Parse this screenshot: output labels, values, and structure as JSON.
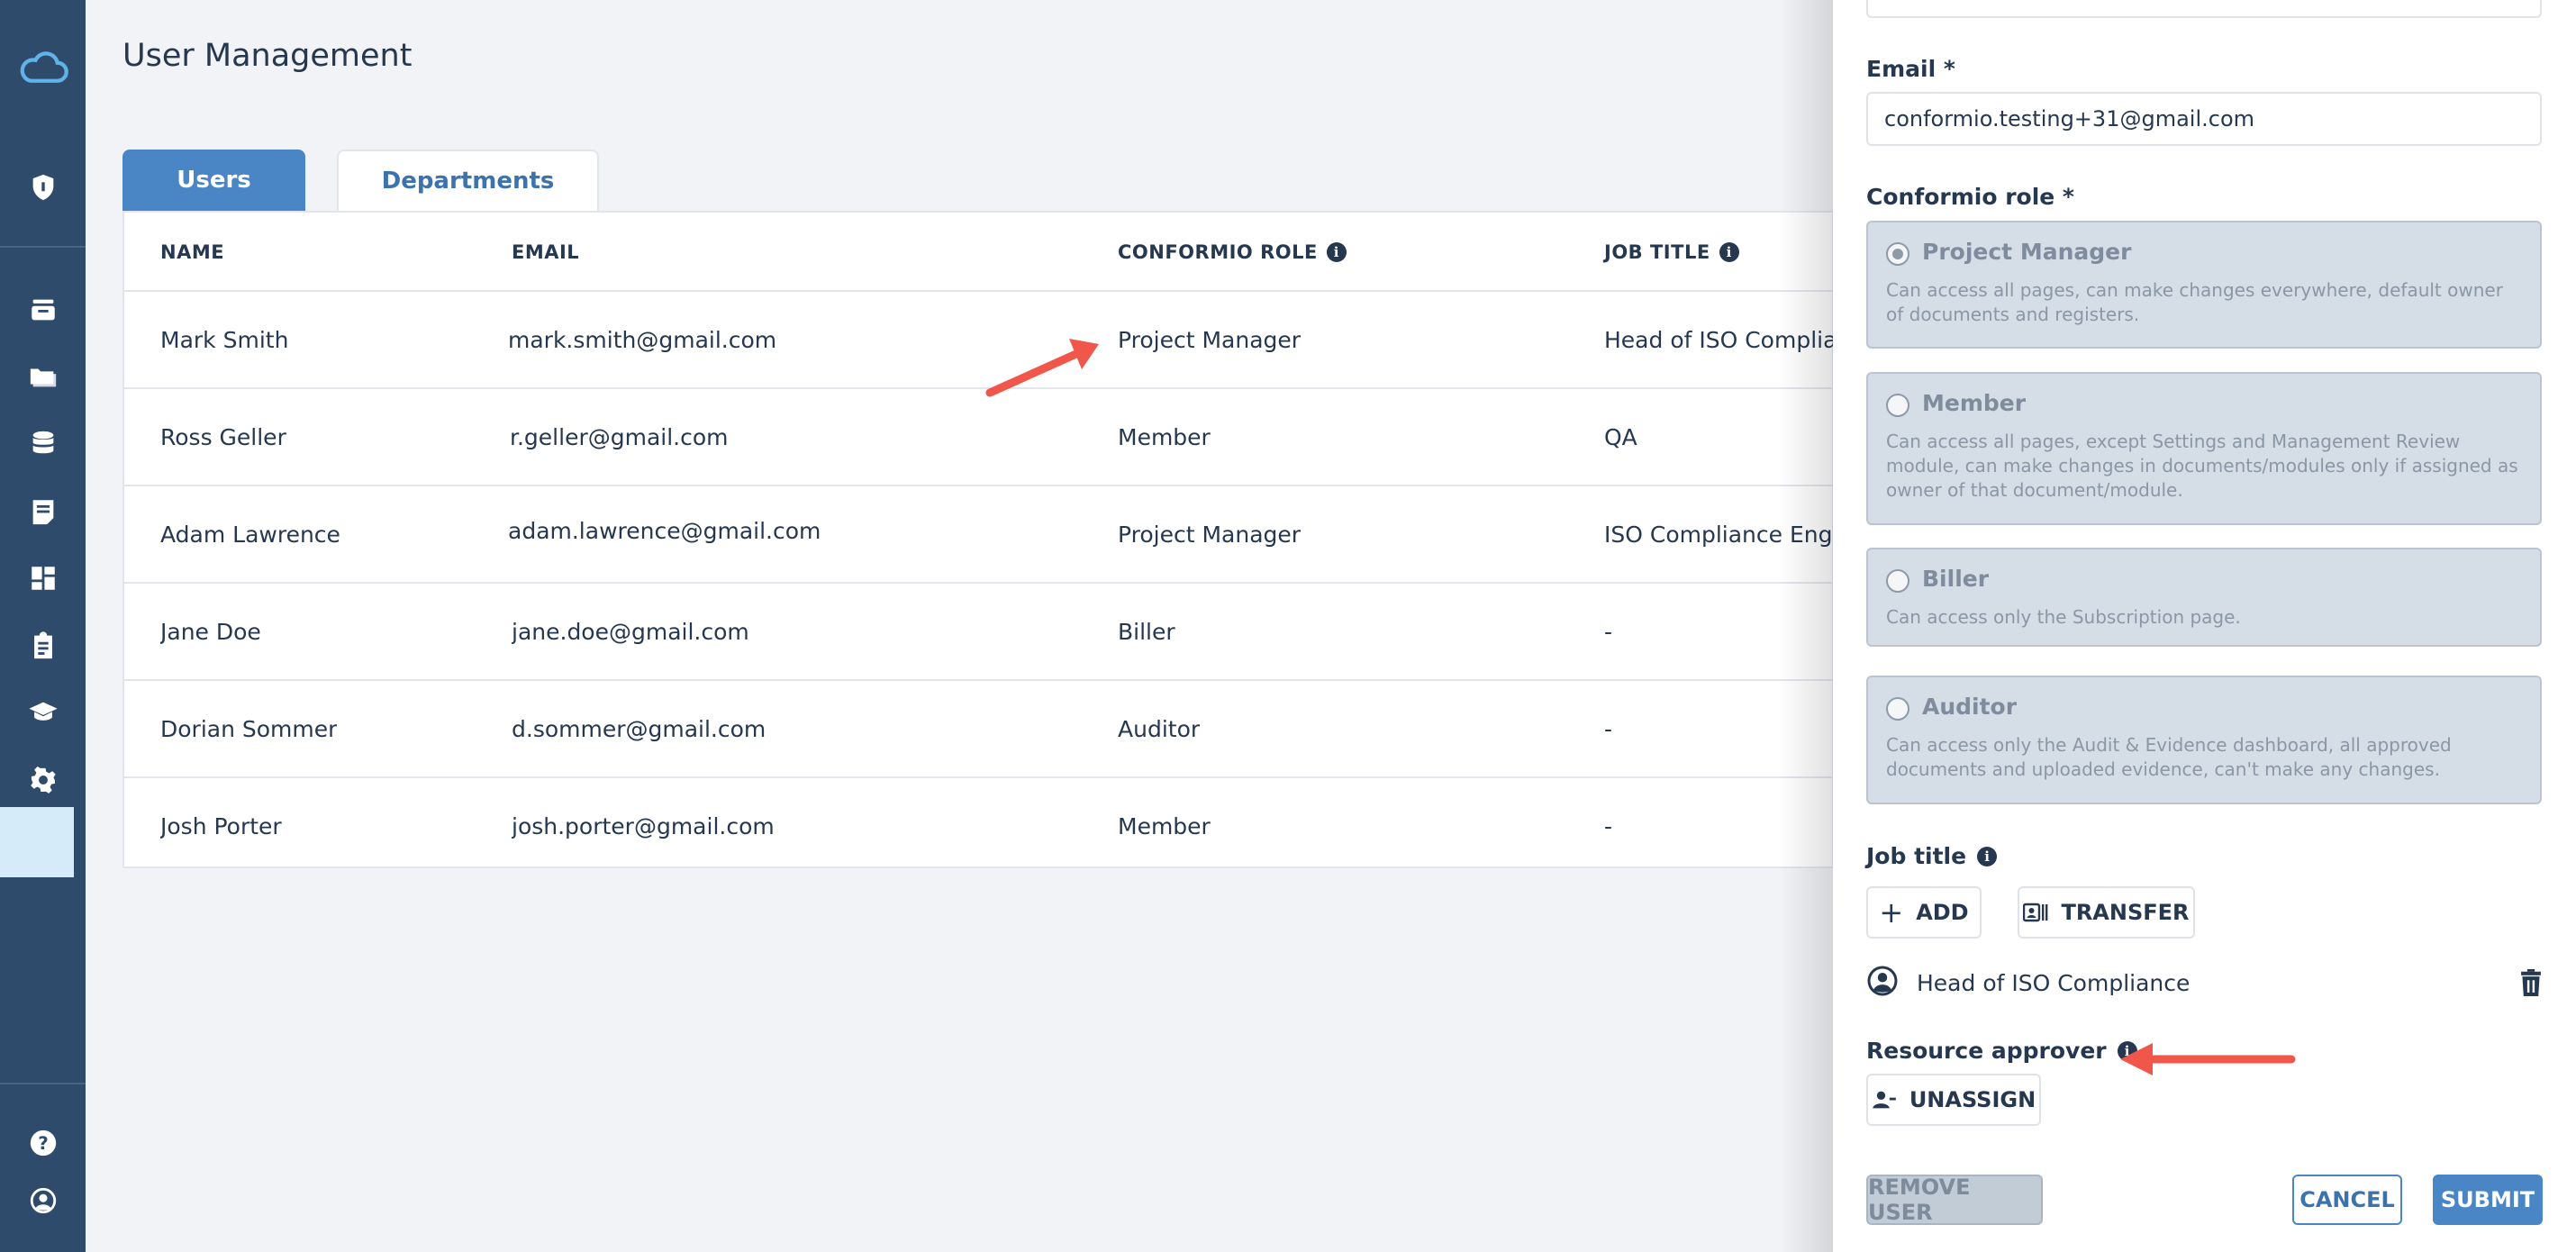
{
  "page": {
    "title": "User Management"
  },
  "tabs": [
    {
      "label": "Users",
      "active": true
    },
    {
      "label": "Departments",
      "active": false
    }
  ],
  "table": {
    "columns": [
      {
        "label": "NAME",
        "info": false
      },
      {
        "label": "EMAIL",
        "info": false
      },
      {
        "label": "CONFORMIO ROLE",
        "info": true
      },
      {
        "label": "JOB TITLE",
        "info": true
      }
    ],
    "rows": [
      {
        "name": "Mark Smith",
        "email": "mark.smith@gmail.com",
        "role": "Project Manager",
        "job": "Head of ISO Compliance"
      },
      {
        "name": "Ross Geller",
        "email": "r.geller@gmail.com",
        "role": "Member",
        "job": "QA"
      },
      {
        "name": "Adam Lawrence",
        "email": "adam.lawrence@gmail.com",
        "role": "Project Manager",
        "job": "ISO Compliance Engineer"
      },
      {
        "name": "Jane Doe",
        "email": "jane.doe@gmail.com",
        "role": "Biller",
        "job": "-"
      },
      {
        "name": "Dorian Sommer",
        "email": "d.sommer@gmail.com",
        "role": "Auditor",
        "job": "-"
      },
      {
        "name": "Josh Porter",
        "email": "josh.porter@gmail.com",
        "role": "Member",
        "job": "-"
      }
    ]
  },
  "drawer": {
    "email_label": "Email *",
    "email_value": "conformio.testing+31@gmail.com",
    "role_label": "Conformio role *",
    "roles": [
      {
        "name": "Project Manager",
        "checked": true,
        "desc": "Can access all pages, can make changes everywhere, default owner of documents and registers."
      },
      {
        "name": "Member",
        "checked": false,
        "desc": "Can access all pages, except Settings and Management Review module, can make changes in documents/modules only if assigned as owner of that document/module."
      },
      {
        "name": "Biller",
        "checked": false,
        "desc": "Can access only the Subscription page."
      },
      {
        "name": "Auditor",
        "checked": false,
        "desc": "Can access only the Audit & Evidence dashboard, all approved documents and uploaded evidence, can't make any changes."
      }
    ],
    "job_title_label": "Job title",
    "add_label": "ADD",
    "transfer_label": "TRANSFER",
    "job_item": "Head of ISO Compliance",
    "resource_approver_label": "Resource approver",
    "unassign_label": "UNASSIGN",
    "remove_label": "REMOVE USER",
    "cancel_label": "CANCEL",
    "submit_label": "SUBMIT"
  },
  "colors": {
    "sidebar": "#2e4b6c",
    "accent": "#4a86c5",
    "annotation_arrow": "#f0574a"
  }
}
